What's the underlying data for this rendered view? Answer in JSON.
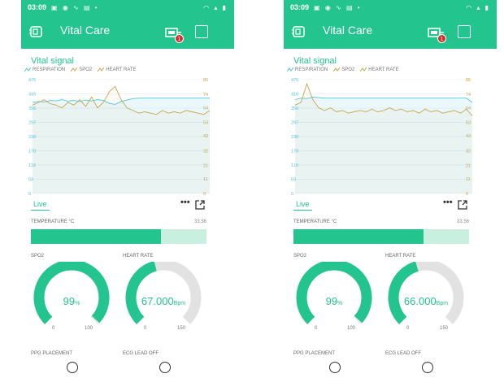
{
  "app": {
    "title": "Vital Care",
    "accent_color": "#23c48e",
    "resp_color": "#52c7dc",
    "hr_color": "#c9a64a",
    "gauge_track_color": "#e2e2e2",
    "badge_count": "1",
    "icons": [
      "back-device-icon",
      "device-chip-icon",
      "square-icon",
      "more-icon",
      "share-icon"
    ]
  },
  "screens": [
    {
      "status": {
        "time": "03:09",
        "notif": "▣ ◉ ∿ ▤ •",
        "sys": "◠ ▴ ▮"
      },
      "chart": {
        "title": "Vital signal",
        "legend": [
          "RESPIRATION",
          "SPO2",
          "HEART RATE"
        ],
        "live_tab": "Live",
        "more_glyph": "•••"
      },
      "temperature": {
        "label": "TEMPERATURE °C",
        "value": "33.56",
        "fill_fraction": 0.74
      },
      "spo2_gauge": {
        "label": "SPO2",
        "value": "99",
        "unit": "%",
        "min": "0",
        "max": "100",
        "fraction": 0.99
      },
      "hr_gauge": {
        "label": "HEART RATE",
        "value": "67.000",
        "unit": "Bpm",
        "min": "0",
        "max": "150",
        "fraction": 0.447
      },
      "ppg_label": "PPG PLACEMENT",
      "ecg_label": "ECG LEAD OFF"
    },
    {
      "status": {
        "time": "03:09",
        "notif": "▣ ◉ ∿ ▤ •",
        "sys": "◠ ▴ ▮"
      },
      "chart": {
        "title": "Vital signal",
        "legend": [
          "RESPIRATION",
          "SPO2",
          "HEART RATE"
        ],
        "live_tab": "Live",
        "more_glyph": "•••"
      },
      "temperature": {
        "label": "TEMPERATURE °C",
        "value": "33.56",
        "fill_fraction": 0.74
      },
      "spo2_gauge": {
        "label": "SPO2",
        "value": "99",
        "unit": "%",
        "min": "0",
        "max": "100",
        "fraction": 0.99
      },
      "hr_gauge": {
        "label": "HEART RATE",
        "value": "66.000",
        "unit": "Bpm",
        "min": "0",
        "max": "150",
        "fraction": 0.44
      },
      "ppg_label": "PPG PLACEMENT",
      "ecg_label": "ECG LEAD OFF"
    }
  ],
  "chart_data": [
    {
      "type": "line",
      "title": "Vital signal",
      "left_axis_ticks": [
        "0",
        "59",
        "119",
        "178",
        "238",
        "297",
        "356",
        "416",
        "475"
      ],
      "right_axis_ticks": [
        "0",
        "11",
        "21",
        "32",
        "43",
        "53",
        "64",
        "74",
        "85"
      ],
      "ylim_left": [
        0,
        475
      ],
      "ylim_right": [
        0,
        85
      ],
      "grid": true,
      "series": [
        {
          "name": "RESPIRATION",
          "axis": "left",
          "values": [
            380,
            384,
            382,
            388,
            386,
            392,
            385,
            388,
            384,
            390,
            386,
            392,
            388,
            376,
            372,
            384,
            390,
            396,
            398,
            398,
            398,
            398,
            398,
            398,
            398,
            398,
            398,
            398,
            398,
            398,
            398
          ]
        },
        {
          "name": "SPO2",
          "axis": "left",
          "values": [
            0
          ]
        },
        {
          "name": "HEART RATE",
          "axis": "right",
          "values": [
            66,
            68,
            70,
            67,
            66,
            64,
            68,
            66,
            70,
            65,
            72,
            64,
            68,
            76,
            80,
            70,
            64,
            62,
            60,
            61,
            60,
            59,
            62,
            60,
            61,
            60,
            62,
            61,
            60,
            59,
            62
          ]
        }
      ]
    },
    {
      "type": "line",
      "title": "Vital signal",
      "left_axis_ticks": [
        "0",
        "59",
        "119",
        "178",
        "238",
        "297",
        "356",
        "416",
        "475"
      ],
      "right_axis_ticks": [
        "0",
        "11",
        "21",
        "32",
        "43",
        "53",
        "64",
        "74",
        "85"
      ],
      "ylim_left": [
        0,
        475
      ],
      "ylim_right": [
        0,
        85
      ],
      "grid": true,
      "series": [
        {
          "name": "RESPIRATION",
          "axis": "left",
          "values": [
            392,
            398,
            396,
            402,
            400,
            398,
            398,
            398,
            398,
            398,
            398,
            398,
            398,
            398,
            398,
            398,
            398,
            398,
            398,
            398,
            398,
            398,
            398,
            398,
            398,
            398,
            398,
            398,
            398,
            398,
            380
          ]
        },
        {
          "name": "SPO2",
          "axis": "left",
          "values": [
            0
          ]
        },
        {
          "name": "HEART RATE",
          "axis": "right",
          "values": [
            66,
            68,
            82,
            70,
            64,
            62,
            64,
            61,
            62,
            60,
            61,
            62,
            61,
            63,
            61,
            62,
            64,
            62,
            63,
            61,
            62,
            60,
            63,
            61,
            62,
            60,
            61,
            62,
            60,
            63,
            58
          ]
        }
      ]
    }
  ]
}
